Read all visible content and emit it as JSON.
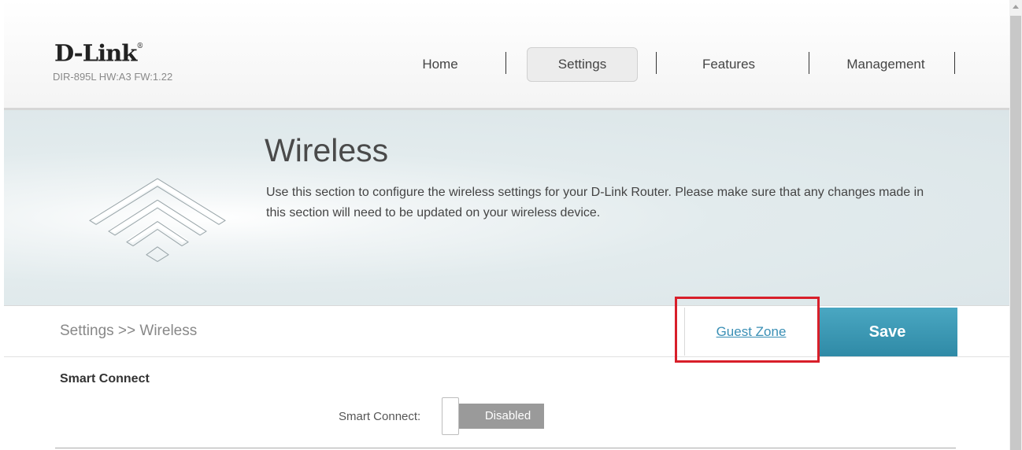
{
  "header": {
    "logo": "D-Link",
    "logo_mark": "®",
    "model": "DIR-895L HW:A3 FW:1.22"
  },
  "nav": {
    "items": [
      {
        "label": "Home",
        "active": false
      },
      {
        "label": "Settings",
        "active": true
      },
      {
        "label": "Features",
        "active": false
      },
      {
        "label": "Management",
        "active": false
      }
    ]
  },
  "banner": {
    "title": "Wireless",
    "description": "Use this section to configure the wireless settings for your D-Link Router. Please make sure that any changes made in this section will need to be updated on your wireless device.",
    "icon": "wifi-icon"
  },
  "action_bar": {
    "breadcrumb": "Settings >> Wireless",
    "guest_zone_label": "Guest Zone",
    "save_label": "Save"
  },
  "smart_connect": {
    "section_title": "Smart Connect",
    "field_label": "Smart Connect:",
    "value": "Disabled"
  },
  "colors": {
    "accent": "#3a8fb5",
    "save_button": "#2f8aa6",
    "highlight": "#d81f2a",
    "toggle_off": "#9a9a9a"
  }
}
